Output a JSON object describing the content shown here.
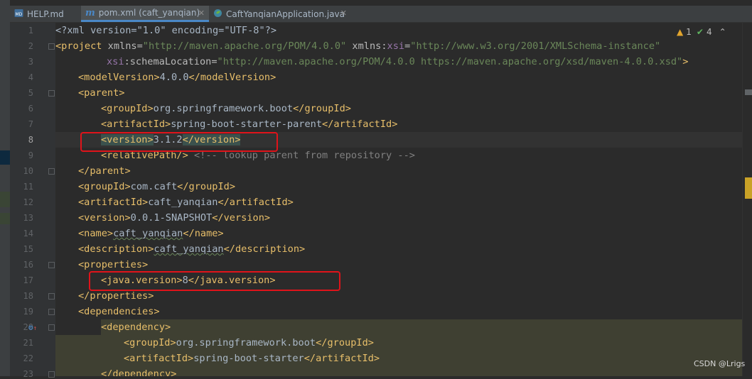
{
  "tabs": [
    {
      "label": "HELP.md",
      "icon": "markdown-file-icon",
      "active": false
    },
    {
      "label": "pom.xml (caft_yanqian)",
      "icon": "maven-m-icon",
      "active": true
    },
    {
      "label": "CaftYanqianApplication.java",
      "icon": "spring-class-icon",
      "active": false
    }
  ],
  "indicators": {
    "warnings": "1",
    "checks": "4"
  },
  "line_numbers": [
    "1",
    "2",
    "3",
    "4",
    "5",
    "6",
    "7",
    "8",
    "9",
    "10",
    "11",
    "12",
    "13",
    "14",
    "15",
    "16",
    "17",
    "18",
    "19",
    "20",
    "21",
    "22",
    "23"
  ],
  "current_line": "8",
  "code": {
    "l1": {
      "pre": "<?xml version=\"1.0\" encoding=\"UTF-8\"?>"
    },
    "l2": {
      "open": "<project",
      "a1": " xmlns=",
      "v1": "\"http://maven.apache.org/POM/4.0.0\"",
      "a2": " xmlns:",
      "ns2": "xsi",
      "eq2": "=",
      "v2": "\"http://www.w3.org/2001/XMLSchema-instance\""
    },
    "l3": {
      "ns": "xsi",
      "attr": ":schemaLocation=",
      "val": "\"http://maven.apache.org/POM/4.0.0 https://maven.apache.org/xsd/maven-4.0.0.xsd\"",
      "close": ">"
    },
    "l4": {
      "open": "<modelVersion>",
      "text": "4.0.0",
      "close": "</modelVersion>"
    },
    "l5": {
      "open": "<parent>"
    },
    "l6": {
      "open": "<groupId>",
      "text": "org.springframework.boot",
      "close": "</groupId>"
    },
    "l7": {
      "open": "<artifactId>",
      "text": "spring-boot-starter-parent",
      "close": "</artifactId>"
    },
    "l8": {
      "open": "<version>",
      "text": "3.1.2",
      "close": "</version>"
    },
    "l9": {
      "open": "<relativePath/>",
      "comment": " <!-- lookup parent from repository -->"
    },
    "l10": {
      "close": "</parent>"
    },
    "l11": {
      "open": "<groupId>",
      "text": "com.caft",
      "close": "</groupId>"
    },
    "l12": {
      "open": "<artifactId>",
      "text": "caft_yanqian",
      "close": "</artifactId>"
    },
    "l13": {
      "open": "<version>",
      "text": "0.0.1-SNAPSHOT",
      "close": "</version>"
    },
    "l14": {
      "open": "<name>",
      "text": "caft_yanqian",
      "close": "</name>"
    },
    "l15": {
      "open": "<description>",
      "text": "caft_yanqian",
      "close": "</description>"
    },
    "l16": {
      "open": "<properties>"
    },
    "l17": {
      "open": "<java.version>",
      "text": "8",
      "close": "</java.version>"
    },
    "l18": {
      "close": "</properties>"
    },
    "l19": {
      "open": "<dependencies>"
    },
    "l20": {
      "open": "<dependency>"
    },
    "l21": {
      "open": "<groupId>",
      "text": "org.springframework.boot",
      "close": "</groupId>"
    },
    "l22": {
      "open": "<artifactId>",
      "text": "spring-boot-starter",
      "close": "</artifactId>"
    },
    "l23": {
      "close": "</dependency>"
    }
  },
  "watermark": "CSDN @Lrigs",
  "colors": {
    "tag": "#e8bf6a",
    "string": "#6a8759",
    "comment": "#808080",
    "annotation": "#e0131a",
    "active_tab": "#4a88c7"
  }
}
